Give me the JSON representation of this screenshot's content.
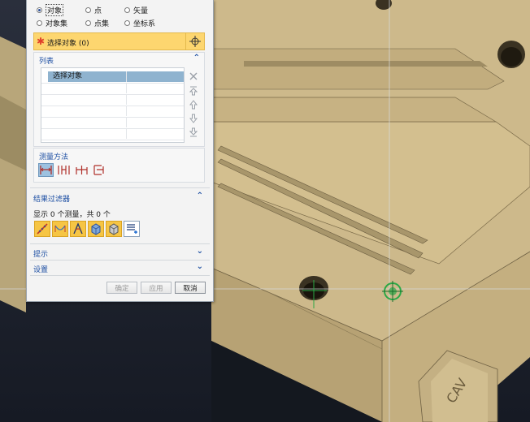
{
  "dialog": {
    "radios": {
      "row1": [
        {
          "label": "对象",
          "checked": true
        },
        {
          "label": "点",
          "checked": false
        },
        {
          "label": "矢量",
          "checked": false
        }
      ],
      "row2": [
        {
          "label": "对象集",
          "checked": false
        },
        {
          "label": "点集",
          "checked": false
        },
        {
          "label": "坐标系",
          "checked": false
        }
      ]
    },
    "select_object_label": "选择对象 (0)",
    "list_section": {
      "title": "列表",
      "rows": [
        "选择对象",
        "",
        "",
        "",
        "",
        ""
      ]
    },
    "measure_method": {
      "title": "测量方法"
    },
    "result_filter": {
      "title": "结果过滤器",
      "summary": "显示 0 个测量，共 0 个"
    },
    "hint_section": {
      "title": "提示"
    },
    "settings_section": {
      "title": "设置"
    },
    "buttons": {
      "ok": "确定",
      "apply": "应用",
      "cancel": "取消"
    }
  },
  "viewport": {
    "part_label": "CAV",
    "colors": {
      "background": "#1a1f2b",
      "part_face": "#cbb889",
      "crosshair": "#2aa845"
    }
  }
}
